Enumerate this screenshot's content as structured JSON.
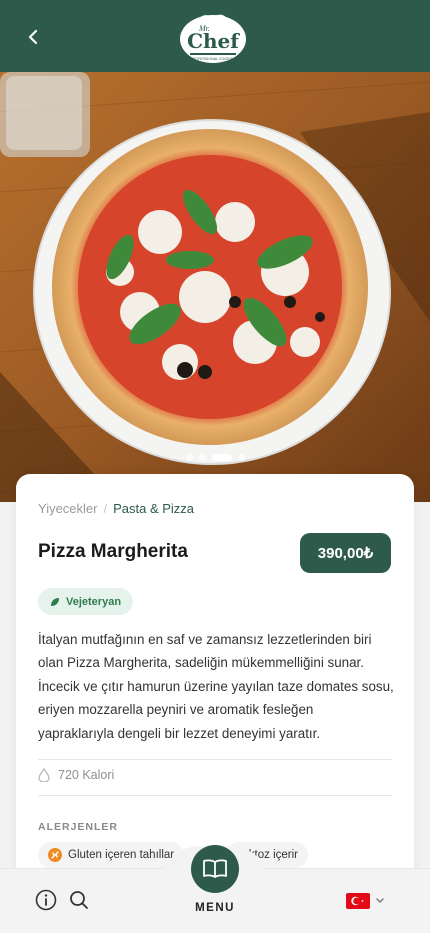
{
  "header": {
    "logo_small": "Mr.",
    "logo_main": "Chef",
    "logo_tagline": "PROFESSIONAL COOKING"
  },
  "carousel": {
    "total": 4,
    "active_index": 2
  },
  "breadcrumb": {
    "parent": "Yiyecekler",
    "separator": "/",
    "current": "Pasta & Pizza"
  },
  "product": {
    "name": "Pizza Margherita",
    "price": "390,00₺",
    "badge": "Vejeteryan",
    "description_lines": [
      "İtalyan mutfağının en saf ve zamansız lezzetlerinden biri",
      "olan Pizza Margherita, sadeliğin mükemmelliğini sunar.",
      "İncecik ve çıtır hamurun üzerine yayılan taze domates sosu,",
      "eriyen mozzarella peyniri ve aromatik fesleğen",
      "yapraklarıyla dengeli bir lezzet deneyimi yaratır."
    ],
    "calories": "720 Kalori"
  },
  "allergens": {
    "heading": "ALERJENLER",
    "items": [
      "Gluten içeren tahıllar",
      "Laktoz içerir"
    ]
  },
  "bottom_nav": {
    "menu_label": "MENU"
  },
  "colors": {
    "brand_green": "#2d5a4b",
    "badge_green": "#2f7d4f",
    "allergen_orange": "#f08a24"
  },
  "icons": [
    "chevron-left-icon",
    "info-icon",
    "search-icon",
    "book-icon",
    "turkey-flag-icon",
    "chevron-down-icon",
    "leaf-icon",
    "drop-icon",
    "wheat-icon"
  ]
}
